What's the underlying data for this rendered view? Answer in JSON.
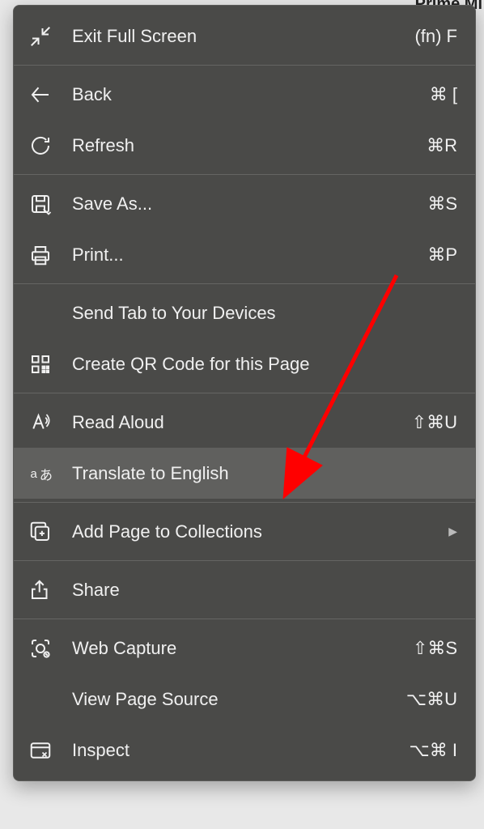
{
  "menu": {
    "sections": [
      [
        {
          "id": "exit-fullscreen",
          "icon": "collapse",
          "label": "Exit Full Screen",
          "shortcut": "(fn) F",
          "submenu": false
        }
      ],
      [
        {
          "id": "back",
          "icon": "arrow-left",
          "label": "Back",
          "shortcut": "⌘ [",
          "submenu": false
        },
        {
          "id": "refresh",
          "icon": "refresh",
          "label": "Refresh",
          "shortcut": "⌘R",
          "submenu": false
        }
      ],
      [
        {
          "id": "save-as",
          "icon": "save",
          "label": "Save As...",
          "shortcut": "⌘S",
          "submenu": false
        },
        {
          "id": "print",
          "icon": "print",
          "label": "Print...",
          "shortcut": "⌘P",
          "submenu": false
        }
      ],
      [
        {
          "id": "send-tab",
          "icon": "",
          "label": "Send Tab to Your Devices",
          "shortcut": "",
          "submenu": false
        },
        {
          "id": "qr-code",
          "icon": "qr",
          "label": "Create QR Code for this Page",
          "shortcut": "",
          "submenu": false
        }
      ],
      [
        {
          "id": "read-aloud",
          "icon": "read-aloud",
          "label": "Read Aloud",
          "shortcut": "⇧⌘U",
          "submenu": false
        },
        {
          "id": "translate",
          "icon": "translate",
          "label": "Translate to English",
          "shortcut": "",
          "submenu": false,
          "highlighted": true
        }
      ],
      [
        {
          "id": "add-collections",
          "icon": "collections",
          "label": "Add Page to Collections",
          "shortcut": "",
          "submenu": true
        }
      ],
      [
        {
          "id": "share",
          "icon": "share",
          "label": "Share",
          "shortcut": "",
          "submenu": false
        }
      ],
      [
        {
          "id": "web-capture",
          "icon": "capture",
          "label": "Web Capture",
          "shortcut": "⇧⌘S",
          "submenu": false
        },
        {
          "id": "view-source",
          "icon": "",
          "label": "View Page Source",
          "shortcut": "⌥⌘U",
          "submenu": false
        },
        {
          "id": "inspect",
          "icon": "inspect",
          "label": "Inspect",
          "shortcut": "⌥⌘ I",
          "submenu": false
        }
      ]
    ]
  },
  "background_text": "Prime Mi",
  "annotation": {
    "arrow_color": "#ff0000"
  }
}
